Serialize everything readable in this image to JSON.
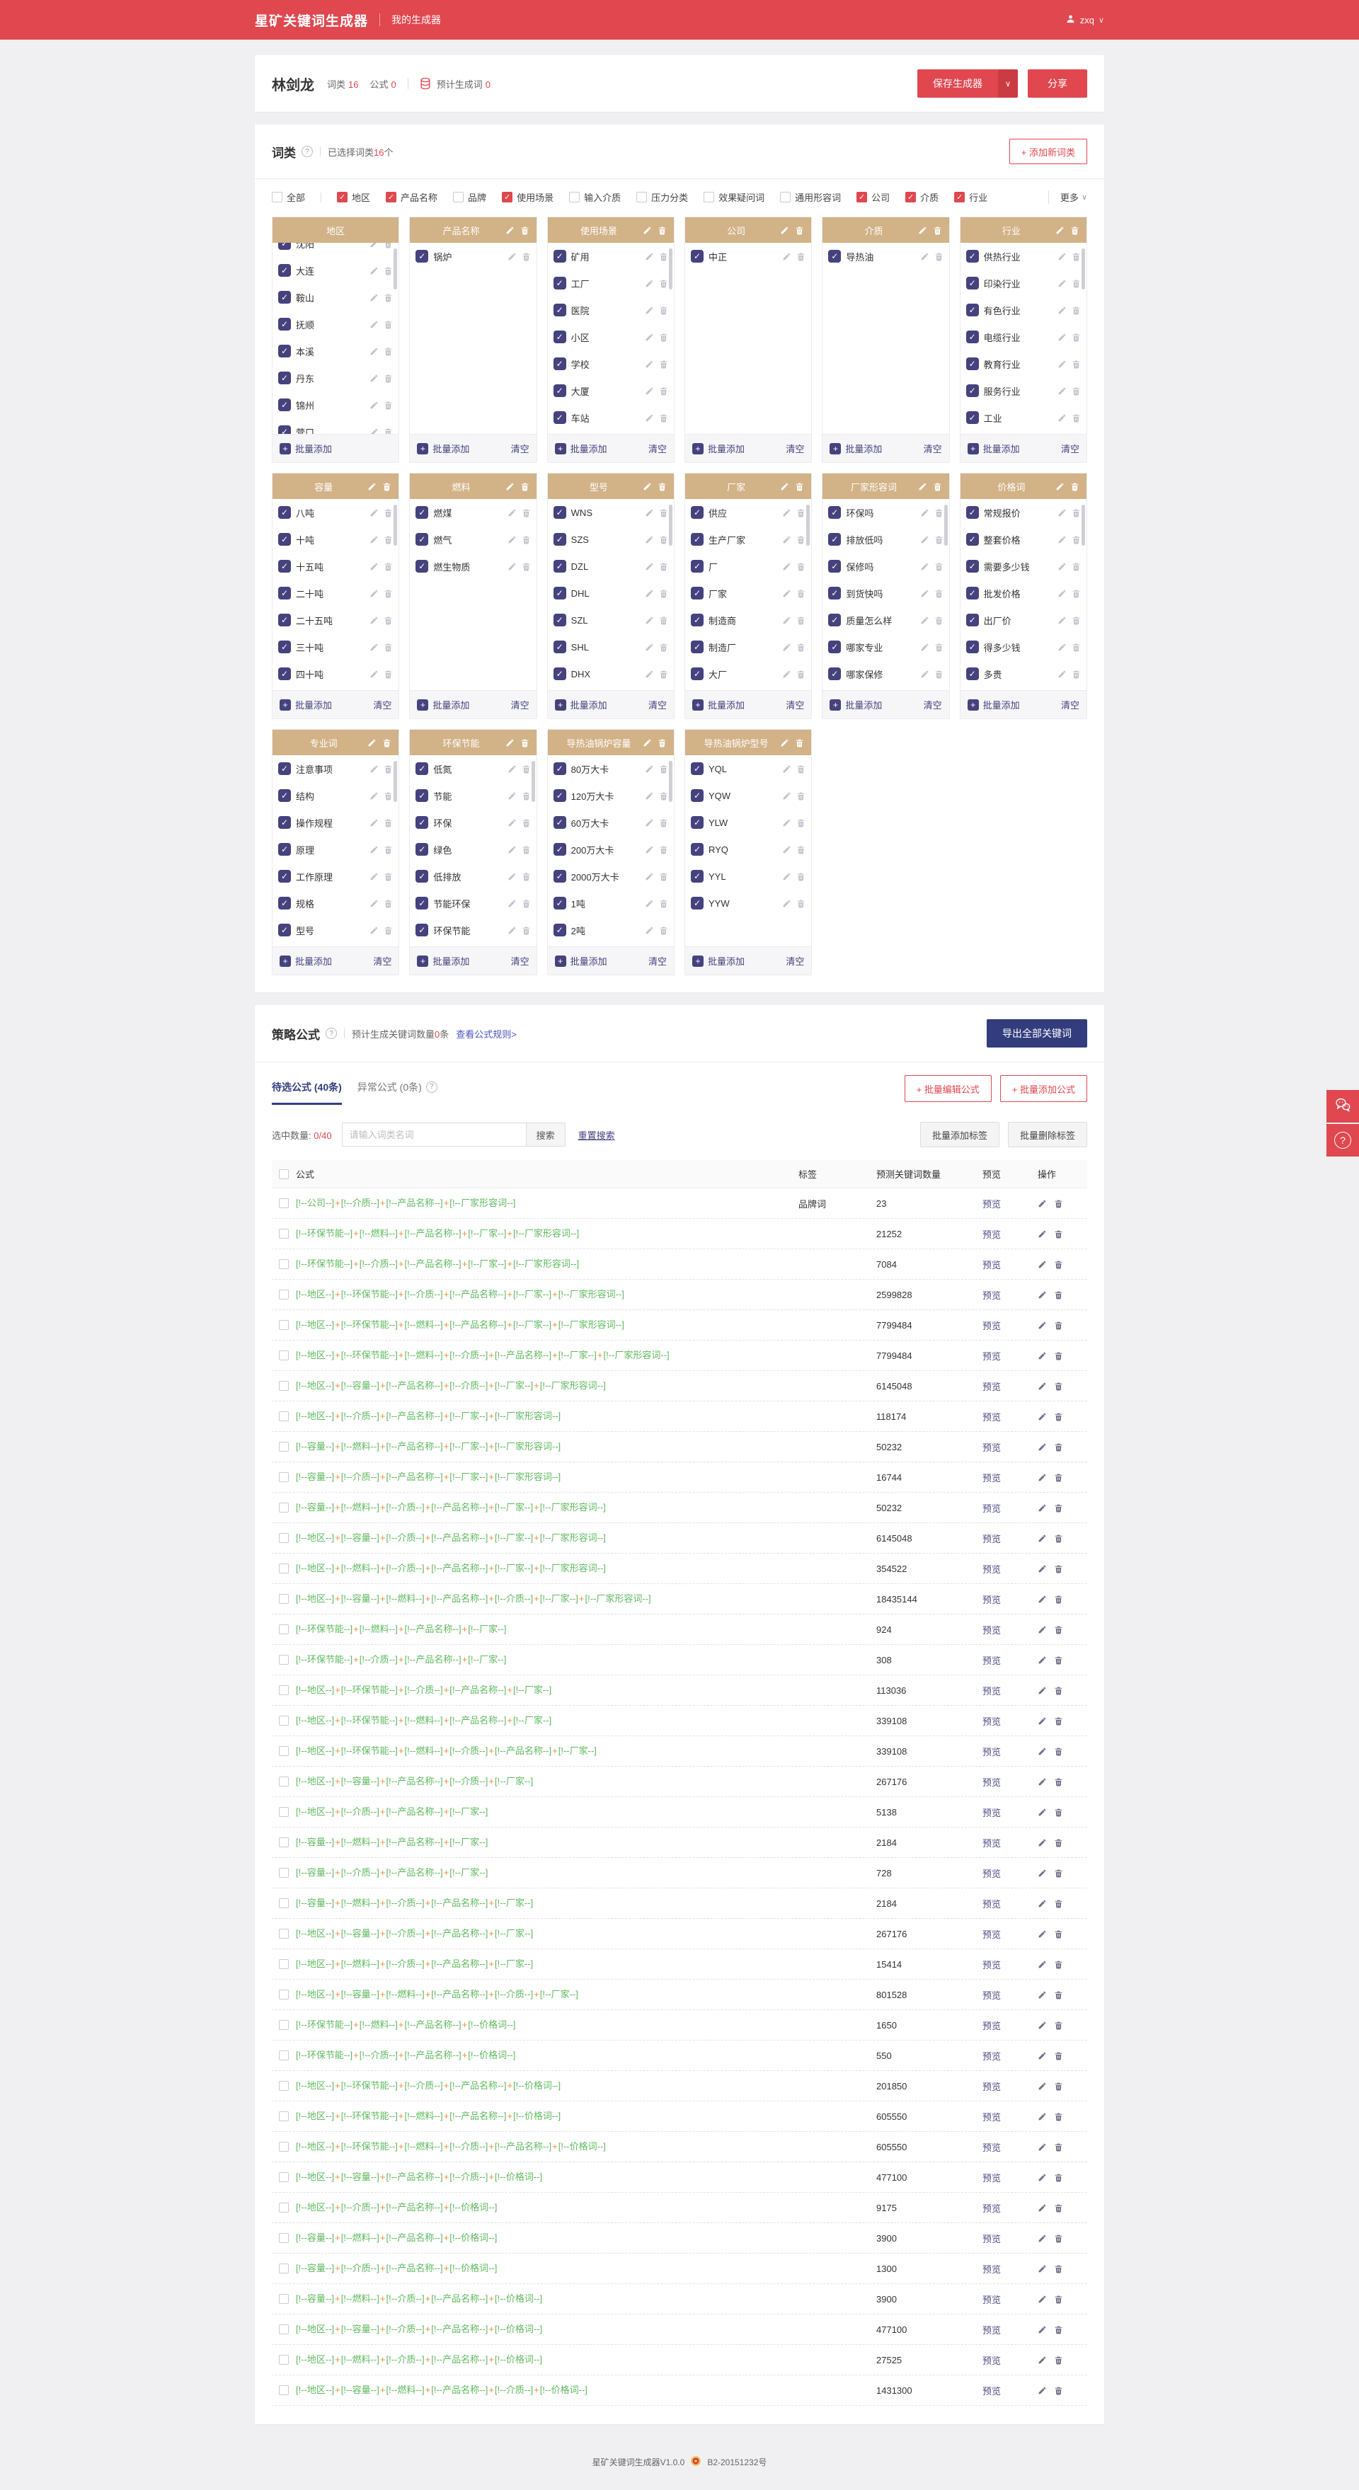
{
  "colors": {
    "primary_red": "#e0474f",
    "navy": "#333d7d",
    "indigo": "#45427e",
    "tan_header": "#d2b287",
    "formula_green": "#5eb95e",
    "plus_orange": "#f08a3c"
  },
  "icons": {
    "question": "?",
    "caret_down": "∨",
    "plus": "+",
    "check": "✓"
  },
  "navbar": {
    "logo": "星矿关键词生成器",
    "nav_item": "我的生成器",
    "username": "zxq"
  },
  "generator": {
    "name": "林剑龙",
    "stats": [
      {
        "label": "词类",
        "value": "16"
      },
      {
        "label": "公式",
        "value": "0"
      }
    ],
    "estimate_label": "预计生成词",
    "estimate_value": "0",
    "save_button": "保存生成器",
    "share_button": "分享"
  },
  "wordclass": {
    "title": "词类",
    "selected_prefix": "已选择词类",
    "selected_count": "16",
    "selected_suffix": "个",
    "add_button": "+ 添加新词类",
    "more_label": "更多",
    "batch_add_label": "批量添加",
    "clear_label": "清空",
    "filters": [
      {
        "label": "全部",
        "checked": false,
        "divider_after": true
      },
      {
        "label": "地区",
        "checked": true
      },
      {
        "label": "产品名称",
        "checked": true
      },
      {
        "label": "品牌",
        "checked": false
      },
      {
        "label": "使用场景",
        "checked": true
      },
      {
        "label": "输入介质",
        "checked": false
      },
      {
        "label": "压力分类",
        "checked": false
      },
      {
        "label": "效果疑问词",
        "checked": false
      },
      {
        "label": "通用形容词",
        "checked": false
      },
      {
        "label": "公司",
        "checked": true
      },
      {
        "label": "介质",
        "checked": true
      },
      {
        "label": "行业",
        "checked": true
      }
    ],
    "cards": [
      {
        "title": "地区",
        "items": [
          "沈阳",
          "大连",
          "鞍山",
          "抚顺",
          "本溪",
          "丹东",
          "锦州",
          "营口"
        ],
        "header_actions": false,
        "clearable": false,
        "scrollbar": true,
        "scrolled": true
      },
      {
        "title": "产品名称",
        "items": [
          "锅炉"
        ],
        "header_actions": true,
        "clearable": true,
        "scrollbar": false
      },
      {
        "title": "使用场景",
        "items": [
          "矿用",
          "工厂",
          "医院",
          "小区",
          "学校",
          "大厦",
          "车站"
        ],
        "header_actions": true,
        "clearable": true,
        "scrollbar": true
      },
      {
        "title": "公司",
        "items": [
          "中正"
        ],
        "header_actions": true,
        "clearable": true,
        "scrollbar": false
      },
      {
        "title": "介质",
        "items": [
          "导热油"
        ],
        "header_actions": true,
        "clearable": true,
        "scrollbar": false
      },
      {
        "title": "行业",
        "items": [
          "供热行业",
          "印染行业",
          "有色行业",
          "电缆行业",
          "教育行业",
          "服务行业",
          "工业"
        ],
        "header_actions": true,
        "clearable": true,
        "scrollbar": true
      },
      {
        "title": "容量",
        "items": [
          "八吨",
          "十吨",
          "十五吨",
          "二十吨",
          "二十五吨",
          "三十吨",
          "四十吨"
        ],
        "header_actions": true,
        "clearable": true,
        "scrollbar": true
      },
      {
        "title": "燃料",
        "items": [
          "燃煤",
          "燃气",
          "燃生物质"
        ],
        "header_actions": true,
        "clearable": true,
        "scrollbar": false
      },
      {
        "title": "型号",
        "items": [
          "WNS",
          "SZS",
          "DZL",
          "DHL",
          "SZL",
          "SHL",
          "DHX"
        ],
        "header_actions": true,
        "clearable": true,
        "scrollbar": true
      },
      {
        "title": "厂家",
        "items": [
          "供应",
          "生产厂家",
          "厂",
          "厂家",
          "制造商",
          "制造厂",
          "大厂"
        ],
        "header_actions": true,
        "clearable": true,
        "scrollbar": true
      },
      {
        "title": "厂家形容词",
        "items": [
          "环保吗",
          "排放低吗",
          "保修吗",
          "到货快吗",
          "质量怎么样",
          "哪家专业",
          "哪家保修"
        ],
        "header_actions": true,
        "clearable": true,
        "scrollbar": true
      },
      {
        "title": "价格词",
        "items": [
          "常规报价",
          "整套价格",
          "需要多少钱",
          "批发价格",
          "出厂价",
          "得多少钱",
          "多贵"
        ],
        "header_actions": true,
        "clearable": true,
        "scrollbar": true
      },
      {
        "title": "专业词",
        "items": [
          "注意事项",
          "结构",
          "操作规程",
          "原理",
          "工作原理",
          "规格",
          "型号"
        ],
        "header_actions": true,
        "clearable": true,
        "scrollbar": true
      },
      {
        "title": "环保节能",
        "items": [
          "低氮",
          "节能",
          "环保",
          "绿色",
          "低排放",
          "节能环保",
          "环保节能"
        ],
        "header_actions": true,
        "clearable": true,
        "scrollbar": true
      },
      {
        "title": "导热油锅炉容量",
        "items": [
          "80万大卡",
          "120万大卡",
          "60万大卡",
          "200万大卡",
          "2000万大卡",
          "1吨",
          "2吨"
        ],
        "header_actions": true,
        "clearable": true,
        "scrollbar": true
      },
      {
        "title": "导热油锅炉型号",
        "items": [
          "YQL",
          "YQW",
          "YLW",
          "RYQ",
          "YYL",
          "YYW"
        ],
        "header_actions": true,
        "clearable": true,
        "scrollbar": false
      }
    ]
  },
  "formula": {
    "title": "策略公式",
    "estimate_prefix": "预计生成关键词数量",
    "estimate_count": "0",
    "estimate_suffix": "条",
    "rules_link": "查看公式规则>",
    "export_button": "导出全部关键词",
    "tabs": [
      {
        "label": "待选公式 (40条)",
        "active": true
      },
      {
        "label": "异常公式 (0条)",
        "active": false
      }
    ],
    "batch_edit_button": "+ 批量编辑公式",
    "batch_add_button": "+ 批量添加公式",
    "selected_label": "选中数量:",
    "selected_value": "0/40",
    "search_placeholder": "请输入词类名词",
    "search_button": "搜索",
    "reset_search": "重置搜索",
    "tag_add_button": "批量添加标签",
    "tag_remove_button": "批量删除标签",
    "columns": {
      "formula": "公式",
      "tag": "标签",
      "count": "预测关键词数量",
      "preview": "预览",
      "ops": "操作"
    },
    "preview_label": "预览",
    "format": {
      "prefix": "[!--",
      "suffix": "--]",
      "separator": "+"
    },
    "rows": [
      {
        "formula": [
          "公司",
          "介质",
          "产品名称",
          "厂家形容词"
        ],
        "tag": "品牌词",
        "count": "23"
      },
      {
        "formula": [
          "环保节能",
          "燃料",
          "产品名称",
          "厂家",
          "厂家形容词"
        ],
        "tag": "",
        "count": "21252"
      },
      {
        "formula": [
          "环保节能",
          "介质",
          "产品名称",
          "厂家",
          "厂家形容词"
        ],
        "tag": "",
        "count": "7084"
      },
      {
        "formula": [
          "地区",
          "环保节能",
          "介质",
          "产品名称",
          "厂家",
          "厂家形容词"
        ],
        "tag": "",
        "count": "2599828"
      },
      {
        "formula": [
          "地区",
          "环保节能",
          "燃料",
          "产品名称",
          "厂家",
          "厂家形容词"
        ],
        "tag": "",
        "count": "7799484"
      },
      {
        "formula": [
          "地区",
          "环保节能",
          "燃料",
          "介质",
          "产品名称",
          "厂家",
          "厂家形容词"
        ],
        "tag": "",
        "count": "7799484"
      },
      {
        "formula": [
          "地区",
          "容量",
          "产品名称",
          "介质",
          "厂家",
          "厂家形容词"
        ],
        "tag": "",
        "count": "6145048"
      },
      {
        "formula": [
          "地区",
          "介质",
          "产品名称",
          "厂家",
          "厂家形容词"
        ],
        "tag": "",
        "count": "118174"
      },
      {
        "formula": [
          "容量",
          "燃料",
          "产品名称",
          "厂家",
          "厂家形容词"
        ],
        "tag": "",
        "count": "50232"
      },
      {
        "formula": [
          "容量",
          "介质",
          "产品名称",
          "厂家",
          "厂家形容词"
        ],
        "tag": "",
        "count": "16744"
      },
      {
        "formula": [
          "容量",
          "燃料",
          "介质",
          "产品名称",
          "厂家",
          "厂家形容词"
        ],
        "tag": "",
        "count": "50232"
      },
      {
        "formula": [
          "地区",
          "容量",
          "介质",
          "产品名称",
          "厂家",
          "厂家形容词"
        ],
        "tag": "",
        "count": "6145048"
      },
      {
        "formula": [
          "地区",
          "燃料",
          "介质",
          "产品名称",
          "厂家",
          "厂家形容词"
        ],
        "tag": "",
        "count": "354522"
      },
      {
        "formula": [
          "地区",
          "容量",
          "燃料",
          "产品名称",
          "介质",
          "厂家",
          "厂家形容词"
        ],
        "tag": "",
        "count": "18435144"
      },
      {
        "formula": [
          "环保节能",
          "燃料",
          "产品名称",
          "厂家"
        ],
        "tag": "",
        "count": "924"
      },
      {
        "formula": [
          "环保节能",
          "介质",
          "产品名称",
          "厂家"
        ],
        "tag": "",
        "count": "308"
      },
      {
        "formula": [
          "地区",
          "环保节能",
          "介质",
          "产品名称",
          "厂家"
        ],
        "tag": "",
        "count": "113036"
      },
      {
        "formula": [
          "地区",
          "环保节能",
          "燃料",
          "产品名称",
          "厂家"
        ],
        "tag": "",
        "count": "339108"
      },
      {
        "formula": [
          "地区",
          "环保节能",
          "燃料",
          "介质",
          "产品名称",
          "厂家"
        ],
        "tag": "",
        "count": "339108"
      },
      {
        "formula": [
          "地区",
          "容量",
          "产品名称",
          "介质",
          "厂家"
        ],
        "tag": "",
        "count": "267176"
      },
      {
        "formula": [
          "地区",
          "介质",
          "产品名称",
          "厂家"
        ],
        "tag": "",
        "count": "5138"
      },
      {
        "formula": [
          "容量",
          "燃料",
          "产品名称",
          "厂家"
        ],
        "tag": "",
        "count": "2184"
      },
      {
        "formula": [
          "容量",
          "介质",
          "产品名称",
          "厂家"
        ],
        "tag": "",
        "count": "728"
      },
      {
        "formula": [
          "容量",
          "燃料",
          "介质",
          "产品名称",
          "厂家"
        ],
        "tag": "",
        "count": "2184"
      },
      {
        "formula": [
          "地区",
          "容量",
          "介质",
          "产品名称",
          "厂家"
        ],
        "tag": "",
        "count": "267176"
      },
      {
        "formula": [
          "地区",
          "燃料",
          "介质",
          "产品名称",
          "厂家"
        ],
        "tag": "",
        "count": "15414"
      },
      {
        "formula": [
          "地区",
          "容量",
          "燃料",
          "产品名称",
          "介质",
          "厂家"
        ],
        "tag": "",
        "count": "801528"
      },
      {
        "formula": [
          "环保节能",
          "燃料",
          "产品名称",
          "价格词"
        ],
        "tag": "",
        "count": "1650"
      },
      {
        "formula": [
          "环保节能",
          "介质",
          "产品名称",
          "价格词"
        ],
        "tag": "",
        "count": "550"
      },
      {
        "formula": [
          "地区",
          "环保节能",
          "介质",
          "产品名称",
          "价格词"
        ],
        "tag": "",
        "count": "201850"
      },
      {
        "formula": [
          "地区",
          "环保节能",
          "燃料",
          "产品名称",
          "价格词"
        ],
        "tag": "",
        "count": "605550"
      },
      {
        "formula": [
          "地区",
          "环保节能",
          "燃料",
          "介质",
          "产品名称",
          "价格词"
        ],
        "tag": "",
        "count": "605550"
      },
      {
        "formula": [
          "地区",
          "容量",
          "产品名称",
          "介质",
          "价格词"
        ],
        "tag": "",
        "count": "477100"
      },
      {
        "formula": [
          "地区",
          "介质",
          "产品名称",
          "价格词"
        ],
        "tag": "",
        "count": "9175"
      },
      {
        "formula": [
          "容量",
          "燃料",
          "产品名称",
          "价格词"
        ],
        "tag": "",
        "count": "3900"
      },
      {
        "formula": [
          "容量",
          "介质",
          "产品名称",
          "价格词"
        ],
        "tag": "",
        "count": "1300"
      },
      {
        "formula": [
          "容量",
          "燃料",
          "介质",
          "产品名称",
          "价格词"
        ],
        "tag": "",
        "count": "3900"
      },
      {
        "formula": [
          "地区",
          "容量",
          "介质",
          "产品名称",
          "价格词"
        ],
        "tag": "",
        "count": "477100"
      },
      {
        "formula": [
          "地区",
          "燃料",
          "介质",
          "产品名称",
          "价格词"
        ],
        "tag": "",
        "count": "27525"
      },
      {
        "formula": [
          "地区",
          "容量",
          "燃料",
          "产品名称",
          "介质",
          "价格词"
        ],
        "tag": "",
        "count": "1431300"
      }
    ]
  },
  "footer": {
    "version": "星矿关键词生成器V1.0.0",
    "icp": "B2-20151232号"
  }
}
